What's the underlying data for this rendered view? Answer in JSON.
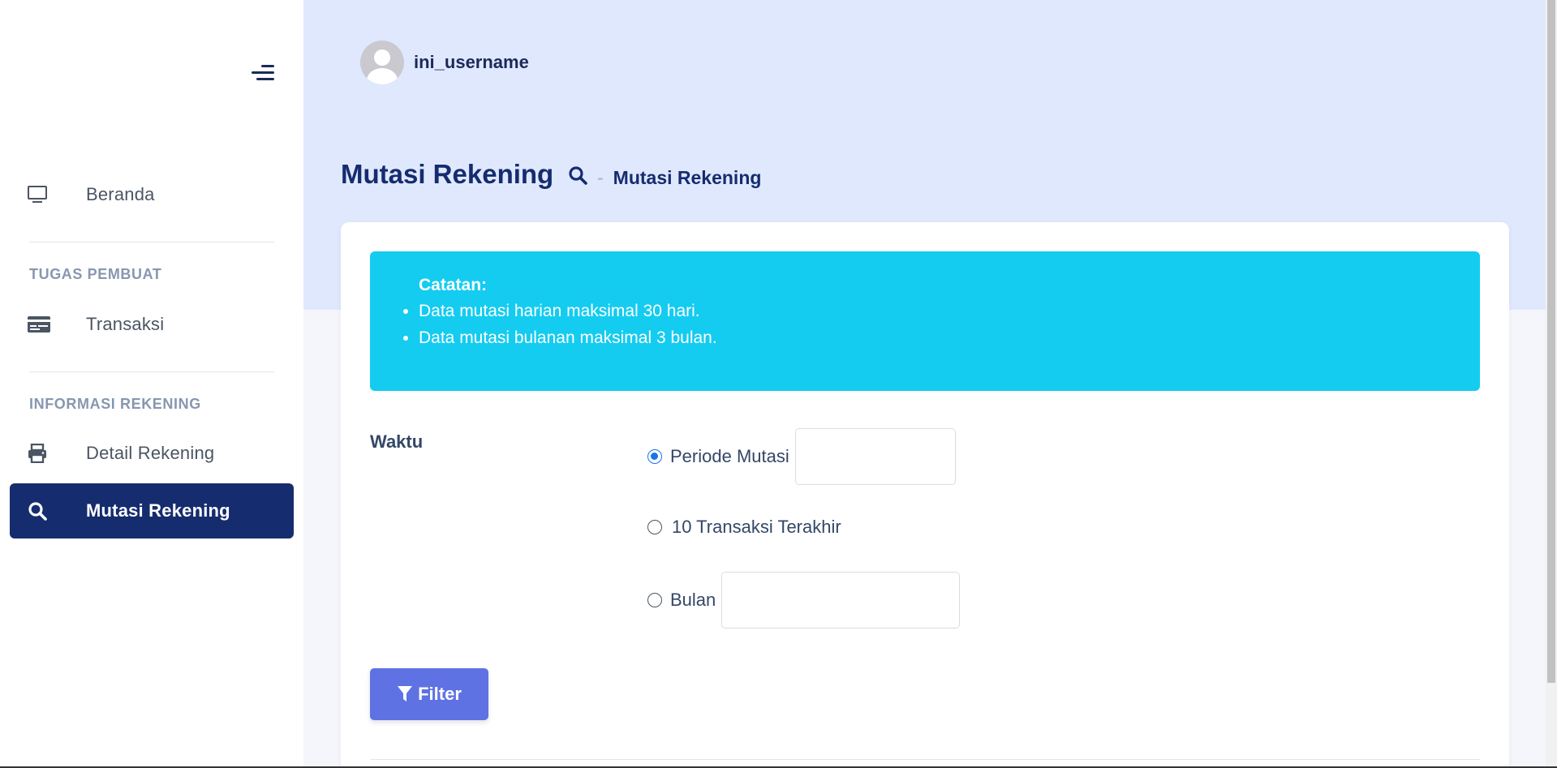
{
  "header": {
    "username": "ini_username"
  },
  "sidebar": {
    "items": [
      {
        "label": "Beranda",
        "icon": "monitor-icon"
      },
      {
        "label": "Transaksi",
        "icon": "card-icon"
      },
      {
        "label": "Detail Rekening",
        "icon": "printer-icon"
      },
      {
        "label": "Mutasi Rekening",
        "icon": "search-icon",
        "active": true
      }
    ],
    "sections": {
      "tugas": "TUGAS PEMBUAT",
      "informasi": "INFORMASI REKENING"
    }
  },
  "page": {
    "title": "Mutasi Rekening",
    "breadcrumb": {
      "sep": "-",
      "current": "Mutasi Rekening"
    }
  },
  "alert": {
    "title": "Catatan:",
    "items": [
      "Data mutasi harian maksimal 30 hari.",
      "Data mutasi bulanan maksimal 3 bulan."
    ]
  },
  "form": {
    "label": "Waktu",
    "options": [
      {
        "label": "Periode Mutasi",
        "checked": true,
        "value": ""
      },
      {
        "label": "10 Transaksi Terakhir",
        "checked": false
      },
      {
        "label": "Bulan",
        "checked": false,
        "value": ""
      }
    ],
    "filter_label": "Filter"
  },
  "colors": {
    "primary_dark": "#152c6e",
    "header_bg": "#e0e8fe",
    "alert_bg": "#13ccf0",
    "button": "#5e72e4"
  }
}
